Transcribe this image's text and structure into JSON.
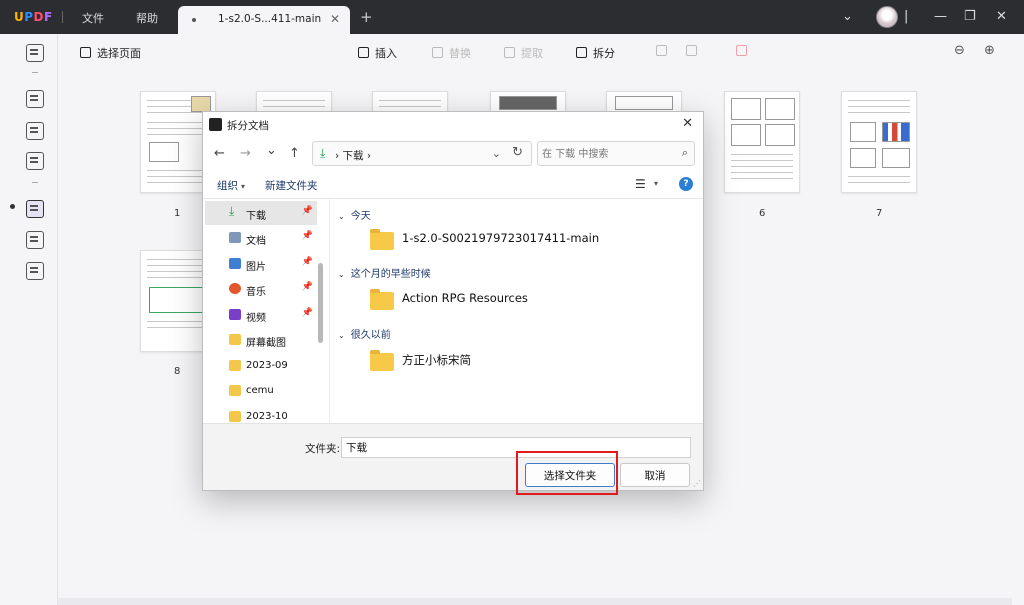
{
  "app": {
    "logo": "UPDF",
    "menu": [
      "文件",
      "帮助"
    ],
    "tab_title": "1-s2.0-S...411-main",
    "tab_add": "+"
  },
  "toolbar": {
    "select_page": "选择页面",
    "insert": "插入",
    "replace": "替换",
    "extract": "提取",
    "split": "拆分"
  },
  "pages": {
    "top_row": [
      "1",
      "6",
      "7"
    ],
    "bottom_row": [
      "8"
    ]
  },
  "dialog": {
    "title": "拆分文档",
    "close": "✕",
    "nav": {
      "back": "←",
      "forward": "→",
      "recent": "⌄",
      "up": "↑"
    },
    "address": {
      "crumb": "下载",
      "sep": "›"
    },
    "search_placeholder": "在 下载 中搜索",
    "commands": {
      "organize": "组织",
      "new_folder": "新建文件夹",
      "help": "?"
    },
    "sidebar": [
      {
        "label": "下载",
        "icon": "download-icon",
        "pinned": true
      },
      {
        "label": "文档",
        "icon": "document-icon",
        "pinned": true
      },
      {
        "label": "图片",
        "icon": "picture-icon",
        "pinned": true
      },
      {
        "label": "音乐",
        "icon": "music-icon",
        "pinned": true
      },
      {
        "label": "视频",
        "icon": "video-icon",
        "pinned": true
      },
      {
        "label": "屏幕截图",
        "icon": "folder-icon",
        "pinned": false
      },
      {
        "label": "2023-09",
        "icon": "folder-icon",
        "pinned": false
      },
      {
        "label": "cemu",
        "icon": "folder-icon",
        "pinned": false
      },
      {
        "label": "2023-10",
        "icon": "folder-icon",
        "pinned": false
      }
    ],
    "groups": [
      {
        "header": "今天",
        "items": [
          "1-s2.0-S0021979723017411-main"
        ]
      },
      {
        "header": "这个月的早些时候",
        "items": [
          "Action RPG Resources"
        ]
      },
      {
        "header": "很久以前",
        "items": [
          "方正小标宋简"
        ]
      }
    ],
    "folder_label": "文件夹:",
    "folder_value": "下载",
    "select_folder_button": "选择文件夹",
    "cancel_button": "取消"
  },
  "colors": {
    "titlebar": "#2b2d31",
    "accent_blue": "#2a7fd4",
    "highlight_red": "#e11b1b",
    "folder_yellow": "#f7c948"
  }
}
